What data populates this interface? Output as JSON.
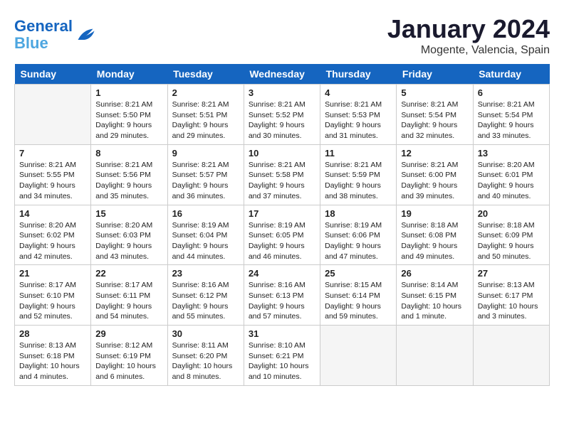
{
  "header": {
    "logo_line1": "General",
    "logo_line2": "Blue",
    "month": "January 2024",
    "location": "Mogente, Valencia, Spain"
  },
  "weekdays": [
    "Sunday",
    "Monday",
    "Tuesday",
    "Wednesday",
    "Thursday",
    "Friday",
    "Saturday"
  ],
  "weeks": [
    [
      {
        "day": null
      },
      {
        "day": "1",
        "sunrise": "8:21 AM",
        "sunset": "5:50 PM",
        "daylight": "9 hours and 29 minutes."
      },
      {
        "day": "2",
        "sunrise": "8:21 AM",
        "sunset": "5:51 PM",
        "daylight": "9 hours and 29 minutes."
      },
      {
        "day": "3",
        "sunrise": "8:21 AM",
        "sunset": "5:52 PM",
        "daylight": "9 hours and 30 minutes."
      },
      {
        "day": "4",
        "sunrise": "8:21 AM",
        "sunset": "5:53 PM",
        "daylight": "9 hours and 31 minutes."
      },
      {
        "day": "5",
        "sunrise": "8:21 AM",
        "sunset": "5:54 PM",
        "daylight": "9 hours and 32 minutes."
      },
      {
        "day": "6",
        "sunrise": "8:21 AM",
        "sunset": "5:54 PM",
        "daylight": "9 hours and 33 minutes."
      }
    ],
    [
      {
        "day": "7",
        "sunrise": "8:21 AM",
        "sunset": "5:55 PM",
        "daylight": "9 hours and 34 minutes."
      },
      {
        "day": "8",
        "sunrise": "8:21 AM",
        "sunset": "5:56 PM",
        "daylight": "9 hours and 35 minutes."
      },
      {
        "day": "9",
        "sunrise": "8:21 AM",
        "sunset": "5:57 PM",
        "daylight": "9 hours and 36 minutes."
      },
      {
        "day": "10",
        "sunrise": "8:21 AM",
        "sunset": "5:58 PM",
        "daylight": "9 hours and 37 minutes."
      },
      {
        "day": "11",
        "sunrise": "8:21 AM",
        "sunset": "5:59 PM",
        "daylight": "9 hours and 38 minutes."
      },
      {
        "day": "12",
        "sunrise": "8:21 AM",
        "sunset": "6:00 PM",
        "daylight": "9 hours and 39 minutes."
      },
      {
        "day": "13",
        "sunrise": "8:20 AM",
        "sunset": "6:01 PM",
        "daylight": "9 hours and 40 minutes."
      }
    ],
    [
      {
        "day": "14",
        "sunrise": "8:20 AM",
        "sunset": "6:02 PM",
        "daylight": "9 hours and 42 minutes."
      },
      {
        "day": "15",
        "sunrise": "8:20 AM",
        "sunset": "6:03 PM",
        "daylight": "9 hours and 43 minutes."
      },
      {
        "day": "16",
        "sunrise": "8:19 AM",
        "sunset": "6:04 PM",
        "daylight": "9 hours and 44 minutes."
      },
      {
        "day": "17",
        "sunrise": "8:19 AM",
        "sunset": "6:05 PM",
        "daylight": "9 hours and 46 minutes."
      },
      {
        "day": "18",
        "sunrise": "8:19 AM",
        "sunset": "6:06 PM",
        "daylight": "9 hours and 47 minutes."
      },
      {
        "day": "19",
        "sunrise": "8:18 AM",
        "sunset": "6:08 PM",
        "daylight": "9 hours and 49 minutes."
      },
      {
        "day": "20",
        "sunrise": "8:18 AM",
        "sunset": "6:09 PM",
        "daylight": "9 hours and 50 minutes."
      }
    ],
    [
      {
        "day": "21",
        "sunrise": "8:17 AM",
        "sunset": "6:10 PM",
        "daylight": "9 hours and 52 minutes."
      },
      {
        "day": "22",
        "sunrise": "8:17 AM",
        "sunset": "6:11 PM",
        "daylight": "9 hours and 54 minutes."
      },
      {
        "day": "23",
        "sunrise": "8:16 AM",
        "sunset": "6:12 PM",
        "daylight": "9 hours and 55 minutes."
      },
      {
        "day": "24",
        "sunrise": "8:16 AM",
        "sunset": "6:13 PM",
        "daylight": "9 hours and 57 minutes."
      },
      {
        "day": "25",
        "sunrise": "8:15 AM",
        "sunset": "6:14 PM",
        "daylight": "9 hours and 59 minutes."
      },
      {
        "day": "26",
        "sunrise": "8:14 AM",
        "sunset": "6:15 PM",
        "daylight": "10 hours and 1 minute."
      },
      {
        "day": "27",
        "sunrise": "8:13 AM",
        "sunset": "6:17 PM",
        "daylight": "10 hours and 3 minutes."
      }
    ],
    [
      {
        "day": "28",
        "sunrise": "8:13 AM",
        "sunset": "6:18 PM",
        "daylight": "10 hours and 4 minutes."
      },
      {
        "day": "29",
        "sunrise": "8:12 AM",
        "sunset": "6:19 PM",
        "daylight": "10 hours and 6 minutes."
      },
      {
        "day": "30",
        "sunrise": "8:11 AM",
        "sunset": "6:20 PM",
        "daylight": "10 hours and 8 minutes."
      },
      {
        "day": "31",
        "sunrise": "8:10 AM",
        "sunset": "6:21 PM",
        "daylight": "10 hours and 10 minutes."
      },
      {
        "day": null
      },
      {
        "day": null
      },
      {
        "day": null
      }
    ]
  ]
}
